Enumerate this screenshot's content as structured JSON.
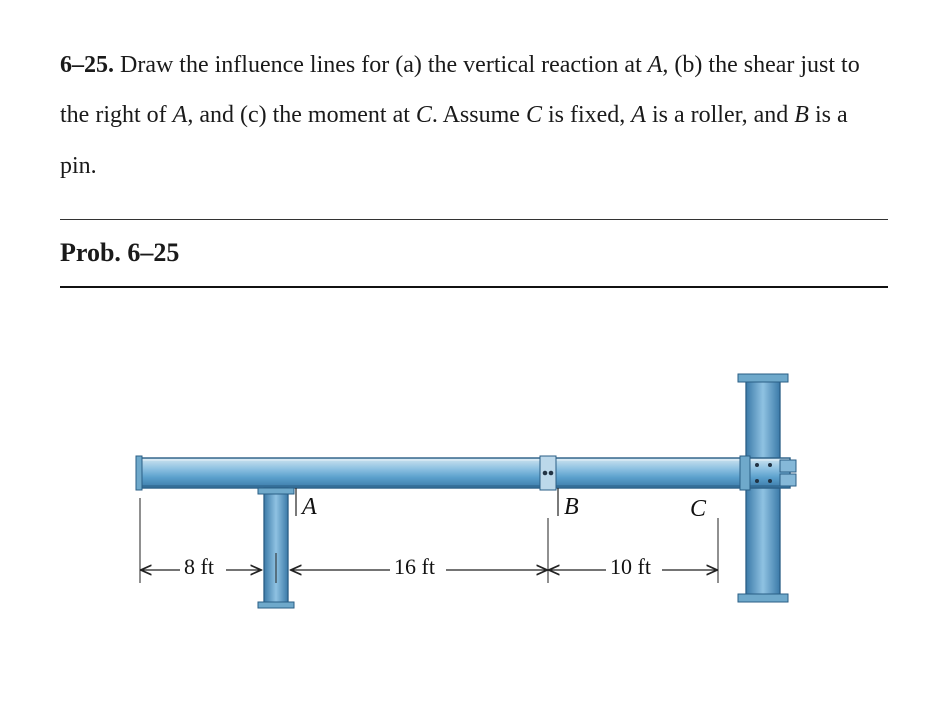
{
  "problem": {
    "number": "6–25.",
    "text_parts": {
      "t1": " Draw the influence lines for (a) the vertical reaction at ",
      "t2": ", (b) the shear just to the right of ",
      "t3": ", and (c) the moment at ",
      "t4": ". Assume ",
      "t5": " is fixed, ",
      "t6": " is a roller, and ",
      "t7": " is a pin."
    },
    "label_A": "A",
    "label_B": "B",
    "label_C": "C",
    "heading": "Prob. 6–25"
  },
  "figure": {
    "labels": {
      "A": "A",
      "B": "B",
      "C": "C"
    },
    "dims": {
      "d1": "8 ft",
      "d2": "16 ft",
      "d3": "10 ft"
    },
    "geometry": {
      "overhang_ft": 8,
      "span_AB_ft": 16,
      "span_BC_ft": 10,
      "support_A": "roller",
      "connection_B": "pin",
      "support_C": "fixed"
    }
  },
  "chart_data": {
    "type": "diagram",
    "description": "Beam with left overhang on roller at A, interior pin at B, fixed support at C.",
    "points_x_ft": {
      "left_end": 0,
      "A": 8,
      "B": 24,
      "C": 34
    },
    "spans": [
      {
        "name": "overhang",
        "from": "left_end",
        "to": "A",
        "length_ft": 8
      },
      {
        "name": "AB",
        "from": "A",
        "to": "B",
        "length_ft": 16
      },
      {
        "name": "BC",
        "from": "B",
        "to": "C",
        "length_ft": 10
      }
    ],
    "supports": [
      {
        "at": "A",
        "type": "roller"
      },
      {
        "at": "B",
        "type": "pin_internal_hinge"
      },
      {
        "at": "C",
        "type": "fixed"
      }
    ]
  }
}
